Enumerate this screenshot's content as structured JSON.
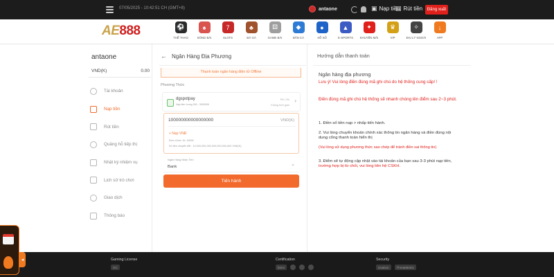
{
  "topbar": {
    "datetime": "07/05/2025 - 10:42:51 CH (GMT+8)",
    "username": "antaone",
    "deposit_label": "Nạp tiền",
    "withdraw_label": "Rút tiền",
    "logout_label": "Đăng xuất"
  },
  "brand": {
    "logo_ae": "AE",
    "logo_num": "888"
  },
  "nav": {
    "items": [
      {
        "label": "THỂ THAO",
        "icon": "soccer-ball-icon",
        "color": "#2b2b2b"
      },
      {
        "label": "SÒNG BÀI",
        "icon": "dealer-icon",
        "color": "#d9534f"
      },
      {
        "label": "SLOTS",
        "icon": "slot-machine-icon",
        "color": "#c62828"
      },
      {
        "label": "ĐÁ GÀ",
        "icon": "rooster-icon",
        "color": "#a0522d"
      },
      {
        "label": "GAME BÀI",
        "icon": "dice-icon",
        "color": "#9e9e9e"
      },
      {
        "label": "BẮN CÁ",
        "icon": "fish-icon",
        "color": "#2e7bd6"
      },
      {
        "label": "XỔ SỐ",
        "icon": "lottery-ball-icon",
        "color": "#1e63c8"
      },
      {
        "label": "E-SPORTS",
        "icon": "gamepad-icon",
        "color": "#3c5cc4"
      },
      {
        "label": "KHUYẾN MÃI",
        "icon": "gift-icon",
        "color": "#e0201b"
      },
      {
        "label": "VIP",
        "icon": "crown-icon",
        "color": "#d4a017"
      },
      {
        "label": "ĐẠI LÝ NGOÀI",
        "icon": "handshake-icon",
        "color": "#444444"
      },
      {
        "label": "APP",
        "icon": "download-icon",
        "color": "#f07a20"
      }
    ]
  },
  "sidebar": {
    "username": "antaone",
    "balance_label": "VND(K)",
    "balance_value": "0.00",
    "menu": [
      {
        "label": "Tài khoản",
        "icon": "account-icon",
        "active": false
      },
      {
        "label": "Nạp tiền",
        "icon": "deposit-icon",
        "active": true
      },
      {
        "label": "Rút tiền",
        "icon": "withdraw-icon",
        "active": false
      },
      {
        "label": "Quảng hỗ tiếp thị",
        "icon": "marketing-icon",
        "active": false
      },
      {
        "label": "Nhật ký nhiệm vụ",
        "icon": "task-log-icon",
        "active": false
      },
      {
        "label": "Lịch sử trò chơi",
        "icon": "game-history-icon",
        "active": false
      },
      {
        "label": "Giao dịch",
        "icon": "transaction-icon",
        "active": false
      },
      {
        "label": "Thông báo",
        "icon": "notification-icon",
        "active": false
      }
    ]
  },
  "main": {
    "title": "Ngân Hàng Địa Phương",
    "offline_notice": "Thanh toán ngân hàng điện tử Offline",
    "method_label": "Phương Thức",
    "method": {
      "name": "dgspotpay",
      "sub": "Nạp tiền: trong 300 - 300000K",
      "right_top": "Phí: 0%",
      "right_bottom": "Không thời gian"
    },
    "amount": {
      "value": "100000000000000000",
      "unit": "VND(K)",
      "quick_label": "+ Nạp VNĐ",
      "hint_min": "Đơn vị tính: 1k: 1000đ",
      "hint_range": "Số tiền chuyển đổi : 10,000,000,000,000,000,000,000 VND(K)"
    },
    "bank": {
      "label": "Ngân Hàng Nhận Tiền",
      "value": "Bank"
    },
    "submit_label": "Tiến hành"
  },
  "guide": {
    "header": "Hướng dẫn thanh toán",
    "subtitle": "Ngân hàng địa phương",
    "warn1": "Lưu ý! Vui lòng điền đúng mã ghi chú do hệ thống cung cấp! !",
    "warn2": "Điền đúng mã ghi chú hệ thống sẽ nhanh chóng lên điểm sau 2~3 phút.",
    "step1": "1. Điền số tiền nạp > nhấp tiến hành.",
    "step2": "2. Vui lòng chuyển khoản chính xác thông tin ngân hàng và điền đúng nội dung cổng thanh toán hiển thị",
    "step2_note": "(Vui lòng sử dụng phương thức sao chép để tránh điền sai thông tin)",
    "step3_text": "3. Điểm sẽ tự động cập nhật vào tài khoản của bạn sau 3-3 phút nạp tiền, ",
    "step3_red": "trường hợp bị từ chối, vui lòng liên hệ CSKH."
  },
  "footer": {
    "license_title": "Gaming License",
    "cert_title": "Certification",
    "security_title": "Security",
    "cert_name": "bmm",
    "security_name1": "iovation",
    "security_name2": "ThreatMetrix",
    "license_name": "GC"
  },
  "colors": {
    "accent": "#f26a2c",
    "danger": "#e0201b",
    "topbar_bg": "#1c1c1c"
  }
}
